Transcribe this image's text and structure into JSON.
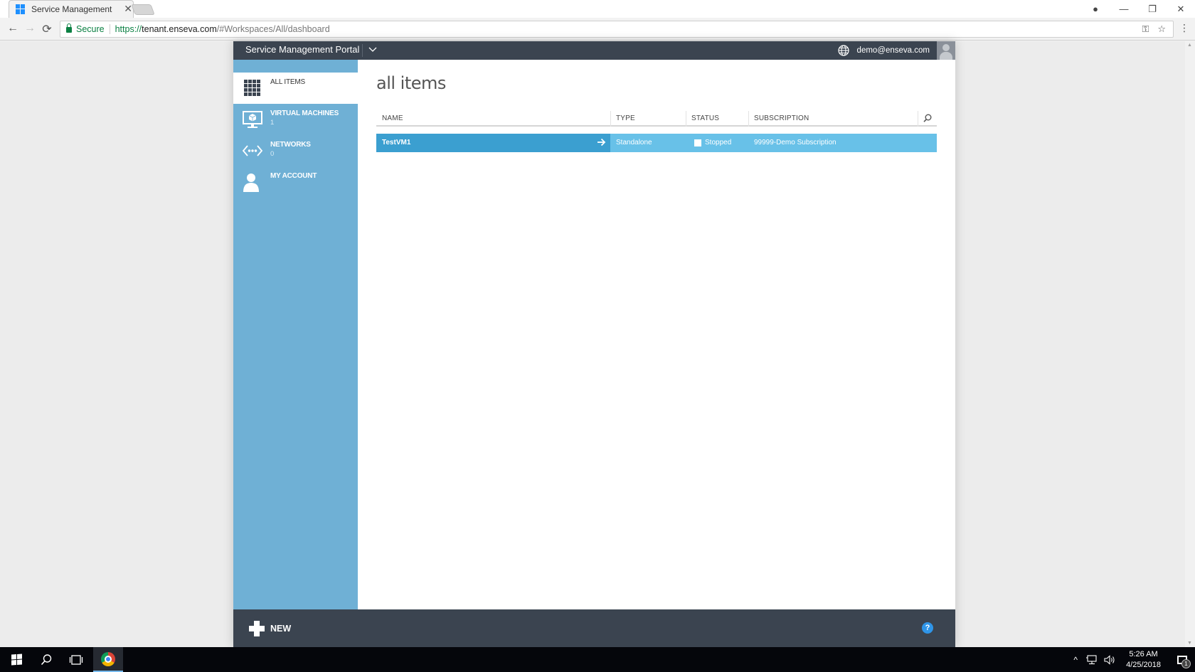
{
  "browser": {
    "tab_title": "Service Management",
    "secure_label": "Secure",
    "url_proto": "https://",
    "url_host": "tenant.enseva.com",
    "url_path": "/#Workspaces/All/dashboard",
    "icons": {
      "back": "←",
      "forward": "→",
      "reload": "⟳",
      "key": "⚿",
      "star": "☆",
      "menu": "⋮",
      "close_tab": "✕",
      "profile": "●",
      "minimize": "—",
      "restore": "❐",
      "close_window": "✕"
    }
  },
  "portal": {
    "title": "Service Management Portal",
    "user_email": "demo@enseva.com",
    "accent_color": "#3b9fd0",
    "sidebar_color": "#6fb0d5",
    "header_color": "#3b4450"
  },
  "sidebar": {
    "items": [
      {
        "label": "ALL ITEMS",
        "count": "",
        "icon": "grid-icon",
        "selected": true
      },
      {
        "label": "VIRTUAL MACHINES",
        "count": "1",
        "icon": "monitor-icon",
        "selected": false
      },
      {
        "label": "NETWORKS",
        "count": "0",
        "icon": "network-icon",
        "selected": false
      },
      {
        "label": "MY ACCOUNT",
        "count": "",
        "icon": "user-icon",
        "selected": false
      }
    ]
  },
  "main": {
    "title": "all items",
    "columns": [
      "NAME",
      "TYPE",
      "STATUS",
      "SUBSCRIPTION"
    ],
    "rows": [
      {
        "name": "TestVM1",
        "type": "Standalone",
        "status": "Stopped",
        "subscription": "99999-Demo Subscription"
      }
    ]
  },
  "bottom": {
    "new_label": "NEW",
    "help_label": "?"
  },
  "taskbar": {
    "time": "5:26 AM",
    "date": "4/25/2018",
    "notification_count": "1",
    "tray_glyphs": {
      "chevron_up": "^",
      "network": "🖧",
      "volume": "🔊"
    }
  }
}
